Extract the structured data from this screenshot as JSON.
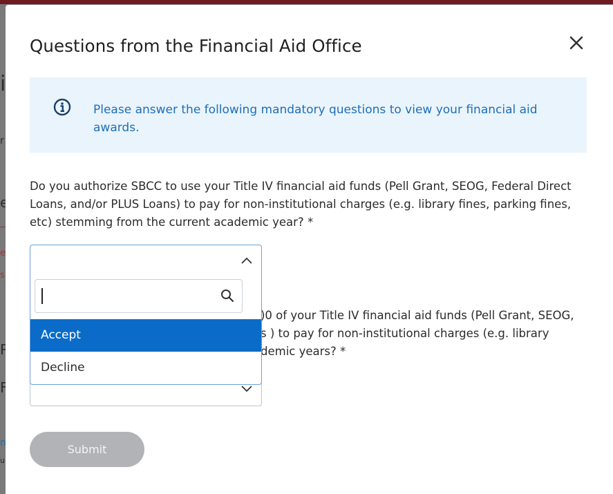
{
  "modal": {
    "title": "Questions from the Financial Aid Office",
    "close_icon": "close-icon"
  },
  "info": {
    "icon": "info-icon",
    "text": "Please answer the following mandatory questions to view your financial aid awards."
  },
  "questions": [
    {
      "text": "Do you authorize SBCC to use your Title IV financial aid funds (Pell Grant, SEOG, Federal Direct Loans, and/or PLUS Loans) to pay for non-institutional charges (e.g. library fines, parking fines, etc) stemming from the current academic year? *",
      "selected_value": ""
    },
    {
      "text_lines": [
        ")0 of your Title IV financial aid funds (Pell Grant, SEOG,",
        "s ) to pay for non-institutional charges (e.g. library",
        "demic years? *"
      ],
      "selected_value": ""
    }
  ],
  "dropdown": {
    "search_value": "",
    "options": [
      "Accept",
      "Decline"
    ],
    "highlighted": "Accept"
  },
  "submit_label": "Submit",
  "colors": {
    "accent": "#0a6cc8",
    "info_bg": "#eaf4fc",
    "info_text": "#1d6fb8",
    "submit_disabled": "#b1b3b6"
  },
  "background": {
    "fragments": [
      "i",
      "r",
      "e",
      "e",
      "s",
      "R",
      "F",
      "n",
      "u"
    ]
  }
}
